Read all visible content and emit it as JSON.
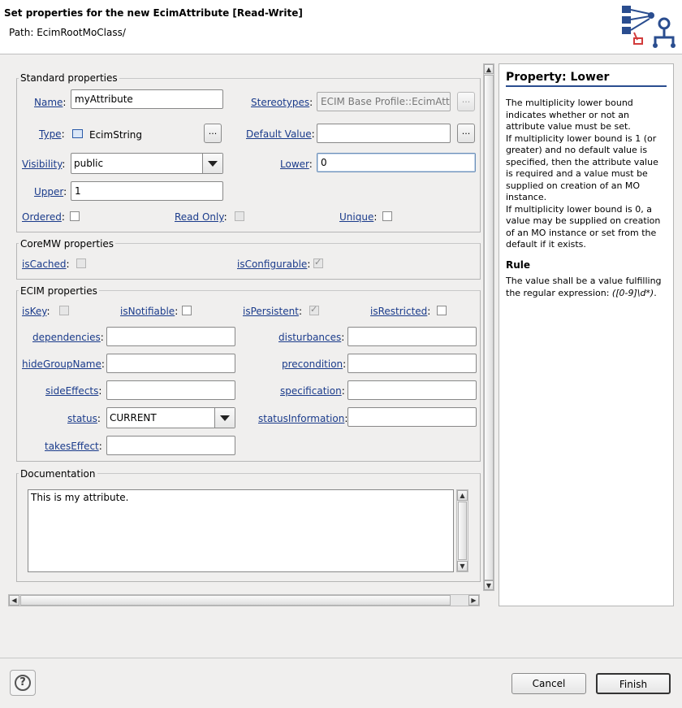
{
  "header": {
    "title": "Set properties for the new EcimAttribute [Read-Write]",
    "path": "Path:  EcimRootMoClass/",
    "logo_icon": "model-hierarchy-icon"
  },
  "standard": {
    "title": "Standard properties",
    "name_label": "Name",
    "name_value": "myAttribute",
    "stereotypes_label": "Stereotypes",
    "stereotypes_value": "ECIM Base Profile::EcimAttribute",
    "type_label": "Type",
    "type_value": "EcimString",
    "default_label": "Default Value",
    "default_value": "",
    "visibility_label": "Visibility",
    "visibility_value": "public",
    "lower_label": "Lower",
    "lower_value": "0",
    "upper_label": "Upper",
    "upper_value": "1",
    "ordered_label": "Ordered",
    "readonly_label": "Read Only",
    "unique_label": "Unique",
    "colon": ":",
    "browse": "..."
  },
  "coremw": {
    "title": "CoreMW properties",
    "iscached_label": "isCached",
    "isconfigurable_label": "isConfigurable"
  },
  "ecim": {
    "title": "ECIM properties",
    "iskey_label": "isKey",
    "isnotifiable_label": "isNotifiable",
    "ispersistent_label": "isPersistent",
    "isrestricted_label": "isRestricted",
    "dependencies_label": "dependencies",
    "disturbances_label": "disturbances",
    "hidegroupname_label": "hideGroupName",
    "precondition_label": "precondition",
    "sideeffects_label": "sideEffects",
    "specification_label": "specification",
    "status_label": "status",
    "status_value": "CURRENT",
    "statusinformation_label": "statusInformation",
    "takeseffect_label": "takesEffect"
  },
  "documentation": {
    "title": "Documentation",
    "text": "This is my attribute."
  },
  "help": {
    "title": "Property: Lower",
    "p1": "The multiplicity lower bound indicates whether or not an attribute value must be set.",
    "p2": "If multiplicity lower bound is 1 (or greater) and no default value is specified, then the attribute value is required and a value must be supplied on creation of an MO instance.",
    "p3": "If multiplicity lower bound is 0, a value may be supplied on creation of an MO instance or set from the default if it exists.",
    "rule_title": "Rule",
    "rule_text": "The value shall be a value fulfilling the regular expression: ",
    "rule_regex": "([0-9]\\d*)",
    "rule_end": "."
  },
  "footer": {
    "help_icon": "help-icon",
    "help_glyph": "?",
    "cancel": "Cancel",
    "finish": "Finish"
  }
}
